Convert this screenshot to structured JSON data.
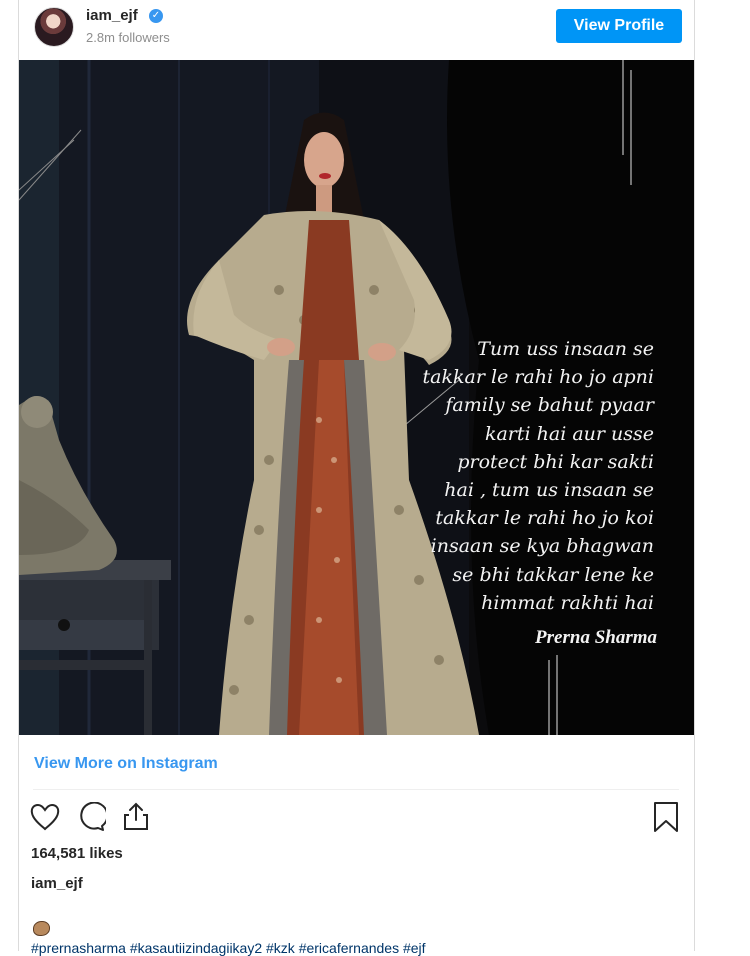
{
  "post": {
    "username": "iam_ejf",
    "followers": "2.8m followers",
    "view_profile_label": "View Profile",
    "quote": "Tum uss insaan se\ntakkar le rahi ho jo apni\nfamily se bahut pyaar\nkarti hai aur usse\nprotect bhi kar sakti\nhai , tum us insaan se\ntakkar le rahi ho jo koi\ninsaan se kya bhagwan\nse bhi takkar lene ke\nhimmat rakhti hai",
    "quote_author": "Prerna Sharma",
    "view_more_label": "View More on Instagram",
    "likes": "164,581 likes",
    "caption_user": "iam_ejf",
    "hashtags": "#prernasharma #kasautiizindagiikay2 #kzk #ericafernandes #ejf",
    "icons": {
      "like": "heart-icon",
      "comment": "comment-icon",
      "share": "share-icon",
      "save": "bookmark-icon",
      "verified": "verified-badge-icon",
      "emoji": "emoji-icon"
    },
    "colors": {
      "accent": "#0095f6",
      "link": "#3897f0"
    }
  }
}
